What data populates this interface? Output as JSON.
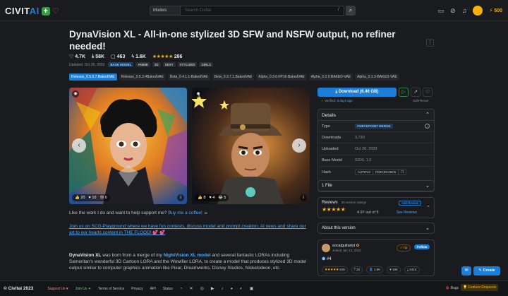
{
  "header": {
    "logo": "CIVITAI",
    "search_scope": "Models",
    "search_placeholder": "Search Civitai",
    "search_shortcut": "/",
    "buzz": "500"
  },
  "model": {
    "title": "DynaVision XL - All-in-one stylized 3D SFW and NSFW output, no refiner needed!",
    "stats": {
      "likes": "4.7K",
      "downloads": "58K",
      "comments": "463",
      "buzz": "1.6K",
      "reviews": "286"
    },
    "updated": "Updated: Oct 26, 2023",
    "tags": [
      "BASE MODEL",
      "ANIME",
      "3D",
      "SEXY",
      "STYLIZED",
      "GIRLS"
    ]
  },
  "versions": [
    "Release_0.5.5.7.BakedVAE",
    "Release_0.5.3.4BakedVAE",
    "Beta_0.4.1.1-BakedVAE",
    "Beta_0.3.7.1.BakedVAE",
    "Alpha_0.3.6.FP16-BakedVAE",
    "Alpha_0.2.0.BAKED-VAE",
    "Alpha_0.1.3-BAKED-VAE"
  ],
  "gallery": {
    "card1": {
      "likes": "20",
      "hearts": "10",
      "cry": "0"
    },
    "card2": {
      "likes": "8",
      "hearts": "4",
      "laugh": "5"
    }
  },
  "support_text": "Like the work I do and want to help support me?",
  "support_link": "Buy me a coffee!",
  "promo_link": "Join us on SCG-Playground where we have fun contests, discuss model and prompt creation, AI news and share our art to our hearts content in THE FLOOD!",
  "description": {
    "name": "DynaVision XL",
    "p1": "was born from a merge of my",
    "link": "NightVision XL model",
    "p2": "and several fantastic LORAs including Sameritan's wonderful 3D Cartoon LORA and the Wowifier LORA, to create a model that produces stylized 3D model output similar to computer graphics animation like Pixar, Dreamworks, Disney Studios, Nickelodeon, etc."
  },
  "sidebar": {
    "download_label": "Download (6.46 GB)",
    "verified": "Verified:",
    "verified_date": "8 days ago",
    "safetensor": "SafeTensor",
    "details_title": "Details",
    "details": {
      "type_key": "Type",
      "type_val": "CHECKPOINT MERGE",
      "downloads_key": "Downloads",
      "downloads_val": "3,730",
      "uploaded_key": "Uploaded",
      "uploaded_val": "Oct 26, 2023",
      "base_key": "Base Model",
      "base_val": "SDXL 1.0",
      "hash_key": "Hash",
      "hash_type": "AUTOV2",
      "hash_val": "FD9CDC26C5"
    },
    "files": "1 File",
    "reviews_title": "Reviews",
    "reviews_count": "30 version ratings",
    "reviews_score": "4.97 out of 5",
    "add_review": "Add Review",
    "see_reviews": "See Reviews",
    "about": "About this version",
    "creator": {
      "name": "socalguitarist",
      "joined": "Joined Jan 13, 2022",
      "tip": "Tip",
      "follow": "Follow",
      "rank": "#4",
      "rating": "849",
      "uploads": "28",
      "followers": "1.8K",
      "likes": "18K",
      "downloads": "241K"
    }
  },
  "fab": {
    "create": "Create"
  },
  "footer": {
    "copyright": "© Civitai 2023",
    "support": "Support Us",
    "join": "Join Us",
    "terms": "Terms of Service",
    "privacy": "Privacy",
    "api": "API",
    "status": "Status",
    "bugs": "Bugs",
    "feature": "Feature Requests"
  }
}
